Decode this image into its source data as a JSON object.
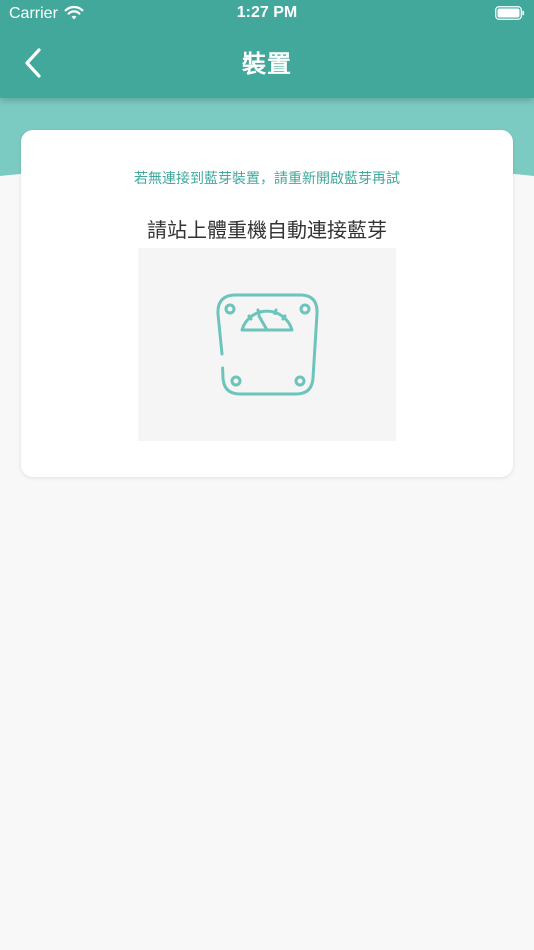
{
  "status_bar": {
    "carrier": "Carrier",
    "time": "1:27 PM",
    "wifi_icon": "wifi-icon",
    "battery_icon": "battery-icon"
  },
  "nav": {
    "title": "裝置",
    "back_icon": "chevron-left-icon"
  },
  "card": {
    "hint": "若無連接到藍芽裝置，請重新開啟藍芽再試",
    "instruction": "請站上體重機自動連接藍芽",
    "illustration_icon": "weight-scale-icon"
  },
  "colors": {
    "primary": "#42a89c",
    "band": "#7ccbc2",
    "background": "#f8f8f8",
    "card": "#ffffff",
    "icon_stroke": "#6cc4bb"
  }
}
